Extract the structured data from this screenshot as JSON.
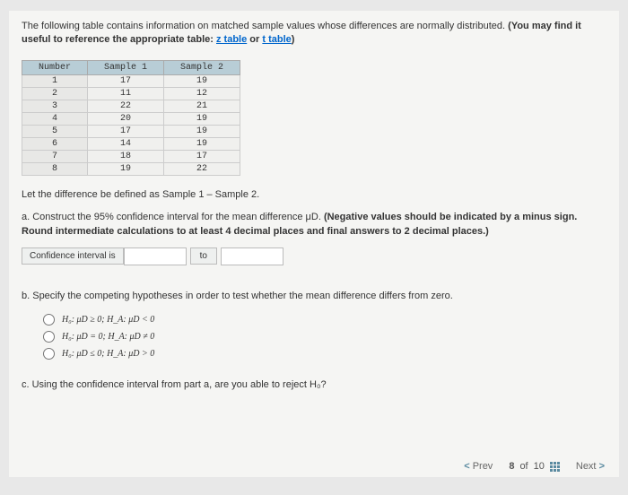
{
  "intro": {
    "line1": "The following table contains information on matched sample values whose differences are normally distributed. ",
    "bold_note": "(You may find it useful to reference the appropriate table: ",
    "link1": "z table",
    "or": " or ",
    "link2": "t table",
    "close": ")"
  },
  "table": {
    "headers": [
      "Number",
      "Sample 1",
      "Sample 2"
    ],
    "rows": [
      [
        "1",
        "17",
        "19"
      ],
      [
        "2",
        "11",
        "12"
      ],
      [
        "3",
        "22",
        "21"
      ],
      [
        "4",
        "20",
        "19"
      ],
      [
        "5",
        "17",
        "19"
      ],
      [
        "6",
        "14",
        "19"
      ],
      [
        "7",
        "18",
        "17"
      ],
      [
        "8",
        "19",
        "22"
      ]
    ]
  },
  "define_text": "Let the difference be defined as Sample 1 – Sample 2.",
  "part_a": {
    "lead": "a. Construct the 95% confidence interval for the mean difference μD. ",
    "bold": "(Negative values should be indicated by a minus sign. Round intermediate calculations to at least 4 decimal places and final answers to 2 decimal places.)"
  },
  "ci": {
    "label": "Confidence interval is",
    "to": "to"
  },
  "part_b": {
    "text": "b. Specify the competing hypotheses in order to test whether the mean difference differs from zero.",
    "opts": {
      "o1": "H₀: μD ≥ 0;  H_A: μD < 0",
      "o2": "H₀: μD = 0;  H_A: μD ≠ 0",
      "o3": "H₀: μD ≤ 0;  H_A: μD > 0"
    }
  },
  "part_c": {
    "text": "c. Using the confidence interval from part a, are you able to reject H₀?"
  },
  "nav": {
    "prev": "Prev",
    "pos": "8",
    "of": "of",
    "total": "10",
    "next": "Next"
  }
}
